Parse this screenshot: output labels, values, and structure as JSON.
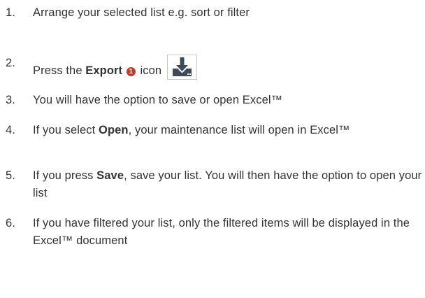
{
  "steps": [
    {
      "number": "1.",
      "text": "Arrange your selected list e.g. sort or filter"
    },
    {
      "number": "2.",
      "before": "Press the ",
      "bold": "Export",
      "badge": "1",
      "after": " icon",
      "icon": "download-icon"
    },
    {
      "number": "3.",
      "text": "You will have the option to save or open Excel™"
    },
    {
      "number": "4.",
      "before": "If you select ",
      "bold": "Open",
      "after": ", your maintenance list will open in Excel™"
    },
    {
      "number": "5.",
      "before": "If you press ",
      "bold": "Save",
      "after": ", save your list. You will then have the option to open your list"
    },
    {
      "number": "6.",
      "text": "If you have filtered your list, only the filtered items will be displayed in the Excel™ document"
    }
  ],
  "colors": {
    "text": "#333333",
    "badge": "#c0392b",
    "icon": "#3d4a57"
  }
}
